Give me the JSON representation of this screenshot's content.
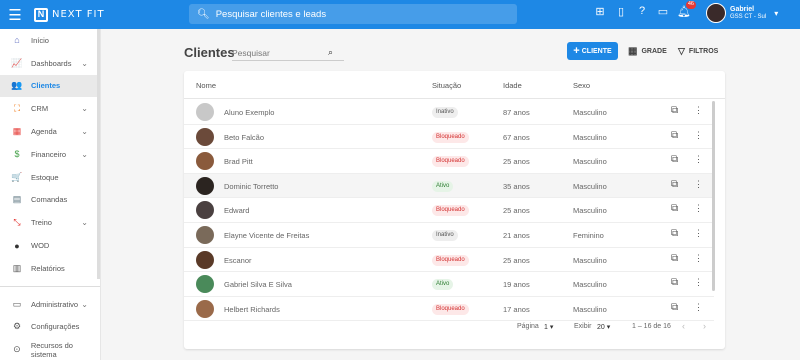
{
  "app": {
    "logo_text": "NEXT FIT",
    "search_placeholder": "Pesquisar clientes e leads",
    "notification_count": "46",
    "user": {
      "name": "Gabriel",
      "unit": "GSS CT - Sul"
    }
  },
  "sidebar": {
    "items": [
      {
        "label": "Início",
        "icon": "home-icon",
        "glyph": "⌂",
        "color": "#5c6bc0",
        "chevron": false
      },
      {
        "label": "Dashboards",
        "icon": "dashboard-icon",
        "glyph": "📈",
        "color": "#7e57c2",
        "chevron": true
      },
      {
        "label": "Clientes",
        "icon": "clients-icon",
        "glyph": "👥",
        "color": "#1e88e5",
        "chevron": false,
        "active": true
      },
      {
        "label": "CRM",
        "icon": "crm-icon",
        "glyph": "⛶",
        "color": "#ef6c00",
        "chevron": true
      },
      {
        "label": "Agenda",
        "icon": "calendar-icon",
        "glyph": "▦",
        "color": "#e53935",
        "chevron": true
      },
      {
        "label": "Financeiro",
        "icon": "money-icon",
        "glyph": "$",
        "color": "#43a047",
        "chevron": true
      },
      {
        "label": "Estoque",
        "icon": "cart-icon",
        "glyph": "🛒",
        "color": "#6d4c41",
        "chevron": false
      },
      {
        "label": "Comandas",
        "icon": "receipt-icon",
        "glyph": "▤",
        "color": "#546e7a",
        "chevron": false
      },
      {
        "label": "Treino",
        "icon": "training-icon",
        "glyph": "⤡",
        "color": "#e53935",
        "chevron": true
      },
      {
        "label": "WOD",
        "icon": "wod-icon",
        "glyph": "●",
        "color": "#333333",
        "chevron": false
      },
      {
        "label": "Relatórios",
        "icon": "reports-icon",
        "glyph": "▥",
        "color": "#555555",
        "chevron": false
      }
    ],
    "bottom_items": [
      {
        "label": "Administrativo",
        "icon": "admin-icon",
        "glyph": "▭",
        "color": "#555555",
        "chevron": true
      },
      {
        "label": "Configurações",
        "icon": "gear-icon",
        "glyph": "⚙",
        "color": "#555555",
        "chevron": false
      },
      {
        "label": "Recursos do sistema",
        "icon": "toggle-icon",
        "glyph": "⊙",
        "color": "#555555",
        "chevron": false
      }
    ]
  },
  "main": {
    "title": "Clientes",
    "search_placeholder": "Pesquisar",
    "btn_cliente": "CLIENTE",
    "btn_grade": "GRADE",
    "btn_filtros": "FILTROS"
  },
  "table": {
    "headers": {
      "name": "Nome",
      "status": "Situação",
      "age": "Idade",
      "sex": "Sexo"
    },
    "rows": [
      {
        "name": "Aluno Exemplo",
        "status": "Inativo",
        "status_type": "inativo",
        "age": "87 anos",
        "sex": "Masculino",
        "avatar_color": "#c8c8c8"
      },
      {
        "name": "Beto Falcão",
        "status": "Bloqueado",
        "status_type": "bloqueado",
        "age": "67 anos",
        "sex": "Masculino",
        "avatar_color": "#6b4a3a"
      },
      {
        "name": "Brad Pitt",
        "status": "Bloqueado",
        "status_type": "bloqueado",
        "age": "25 anos",
        "sex": "Masculino",
        "avatar_color": "#8a5a3c"
      },
      {
        "name": "Dominic Torretto",
        "status": "Ativo",
        "status_type": "ativo",
        "age": "35 anos",
        "sex": "Masculino",
        "avatar_color": "#2b2420"
      },
      {
        "name": "Edward",
        "status": "Bloqueado",
        "status_type": "bloqueado",
        "age": "25 anos",
        "sex": "Masculino",
        "avatar_color": "#4a4040"
      },
      {
        "name": "Elayne Vicente de Freitas",
        "status": "Inativo",
        "status_type": "inativo",
        "age": "21 anos",
        "sex": "Feminino",
        "avatar_color": "#7a6a5a"
      },
      {
        "name": "Escanor",
        "status": "Bloqueado",
        "status_type": "bloqueado",
        "age": "25 anos",
        "sex": "Masculino",
        "avatar_color": "#5a3a28"
      },
      {
        "name": "Gabriel Silva E Silva",
        "status": "Ativo",
        "status_type": "ativo",
        "age": "19 anos",
        "sex": "Masculino",
        "avatar_color": "#4a8a5a"
      },
      {
        "name": "Helbert Richards",
        "status": "Bloqueado",
        "status_type": "bloqueado",
        "age": "17 anos",
        "sex": "Masculino",
        "avatar_color": "#9a6a4a"
      }
    ]
  },
  "footer": {
    "page_label": "Página",
    "page_value": "1",
    "show_label": "Exibir",
    "show_value": "20",
    "range": "1 – 16 de 16"
  }
}
